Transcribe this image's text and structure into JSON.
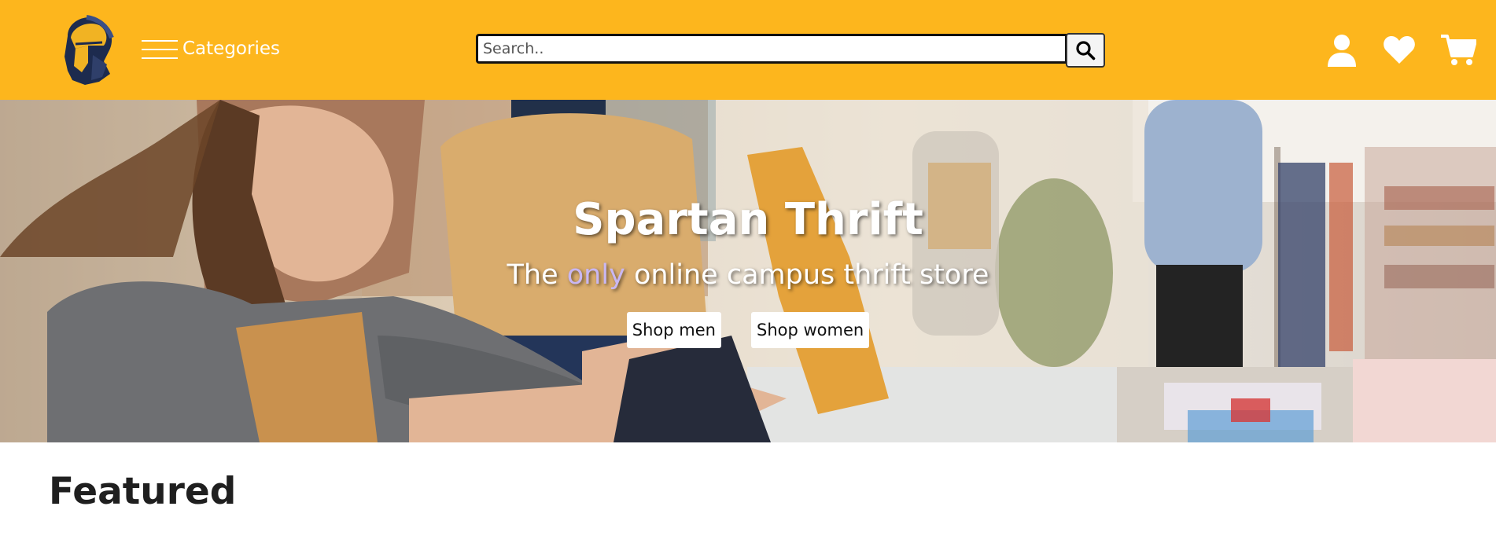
{
  "header": {
    "background": "#fdb61d",
    "logo_icon": "spartan-helmet-icon",
    "categories_label": "Categories",
    "categories_icon": "hamburger-menu-icon",
    "search": {
      "placeholder": "Search..",
      "value": "",
      "button_icon": "search-icon"
    },
    "nav_icons": [
      "user-icon",
      "heart-icon",
      "cart-icon"
    ]
  },
  "hero": {
    "title": "Spartan Thrift",
    "subtitle_before": "The ",
    "subtitle_accent": "only",
    "subtitle_after": " online campus thrift store",
    "accent_color": "#c9b7f2",
    "buttons": {
      "men": "Shop men",
      "women": "Shop women"
    }
  },
  "featured": {
    "title": "Featured"
  }
}
